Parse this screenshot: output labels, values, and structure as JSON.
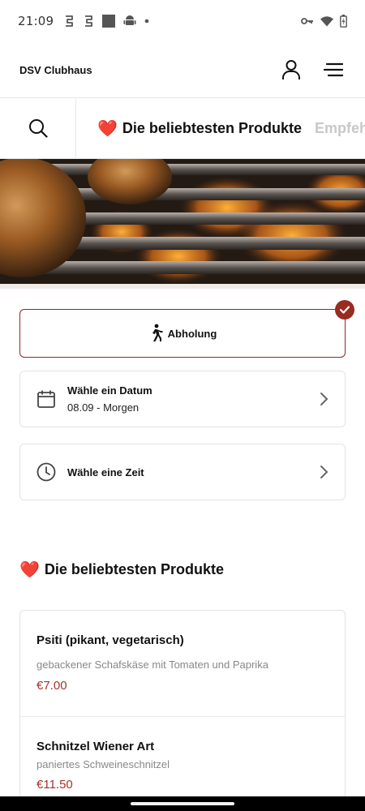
{
  "status_bar": {
    "time": "21:09",
    "left_icons": [
      "nfc-icon",
      "nfc-icon",
      "square-icon",
      "android-icon",
      "dot-icon"
    ],
    "right_icons": [
      "vpn-key-icon",
      "wifi-icon",
      "battery-icon"
    ]
  },
  "header": {
    "title": "DSV Clubhaus",
    "icons": [
      "user-icon",
      "menu-icon"
    ]
  },
  "categories": {
    "tabs": [
      {
        "label": "Die beliebtesten Produkte",
        "emoji": "❤️",
        "active": true
      },
      {
        "label": "Empfehlungen",
        "emoji": "",
        "active": false
      }
    ]
  },
  "hero": {
    "image": "grilled-chicken-on-grill"
  },
  "order": {
    "pickup_label": "Abholung",
    "pickup_selected": true,
    "date_title": "Wähle ein Datum",
    "date_value": "08.09 - Morgen",
    "time_title": "Wähle eine Zeit"
  },
  "section": {
    "title": "Die beliebtesten Produkte",
    "emoji": "❤️"
  },
  "products": [
    {
      "name": "Psiti (pikant, vegetarisch)",
      "description": "gebackener Schafskäse mit Tomaten und Paprika",
      "price": "€7.00"
    },
    {
      "name": "Schnitzel Wiener Art",
      "description": "paniertes Schweineschnitzel",
      "price": "€11.50"
    }
  ],
  "colors": {
    "accent": "#9a2b21",
    "price": "#a3342a",
    "heart": "#d62a2a"
  }
}
